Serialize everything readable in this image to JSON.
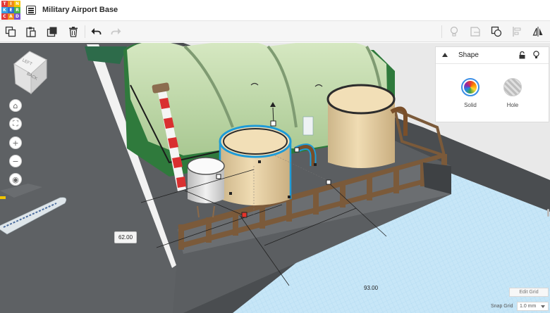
{
  "app": {
    "logo_letters": [
      "T",
      "I",
      "N",
      "K",
      "E",
      "R",
      "C",
      "A",
      "D"
    ],
    "title": "Military Airport Base"
  },
  "toolbar": {
    "left_tools": [
      "copy-icon",
      "paste-icon",
      "duplicate-icon",
      "trash-icon",
      "undo-icon",
      "redo-icon"
    ],
    "right_tools": [
      "lightbulb-icon",
      "note-icon",
      "group-icon",
      "align-icon",
      "mirror-icon"
    ]
  },
  "nav": {
    "view_cube_labels": {
      "front_face": "BACK",
      "top_face": "LEFT"
    },
    "buttons": [
      "home-icon",
      "fit-icon",
      "zoom-in-icon",
      "zoom-out-icon",
      "perspective-icon"
    ]
  },
  "shape_panel": {
    "title": "Shape",
    "solid_label": "Solid",
    "hole_label": "Hole",
    "selected": "Solid"
  },
  "dimensions": {
    "width_value": "62.00",
    "length_value": "93.00"
  },
  "grid": {
    "edit_label": "Edit Grid",
    "snap_label": "Snap Grid",
    "snap_value": "1.0 mm"
  },
  "colors": {
    "selection": "#1e9bd7",
    "tank": "#e8d3a8",
    "roof": "#c8dfb1",
    "workplane": "#c3e3f5"
  }
}
